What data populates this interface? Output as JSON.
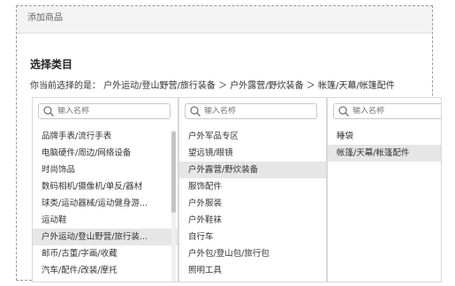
{
  "window": {
    "title": "添加商品"
  },
  "section": {
    "title": "选择类目"
  },
  "current_path": {
    "text": "你当前选择的是： 户外运动/登山野营/旅行装备 ＞ 户外露营/野炊装备 ＞ 帐篷/天幕/帐篷配件"
  },
  "columns": [
    {
      "search_placeholder": "输入名称",
      "items": [
        "品牌手表/流行手表",
        "电脑硬件/周边/网络设备",
        "时尚饰品",
        "数码相机/摄像机/单反/器材",
        "球类/运动器械/运动健身游...",
        "运动鞋",
        "户外运动/登山野营/旅行装...",
        "邮币/古董/字画/收藏",
        "汽车/配件/改装/摩托"
      ],
      "selected_index": 6
    },
    {
      "search_placeholder": "输入名称",
      "items": [
        "户外军品专区",
        "望远镜/眼镜",
        "户外露营/野炊装备",
        "服饰配件",
        "户外服装",
        "户外鞋袜",
        "自行车",
        "户外包/登山包/旅行包",
        "照明工具"
      ],
      "selected_index": 2
    },
    {
      "search_placeholder": "输入名称",
      "items": [
        "睡袋",
        "帐篷/天幕/帐篷配件"
      ],
      "selected_index": 1
    }
  ],
  "colors": {
    "selected_bg": "#e6e6e6",
    "border": "#d8d8d8",
    "titlebar_bg": "#f3f3f3"
  }
}
